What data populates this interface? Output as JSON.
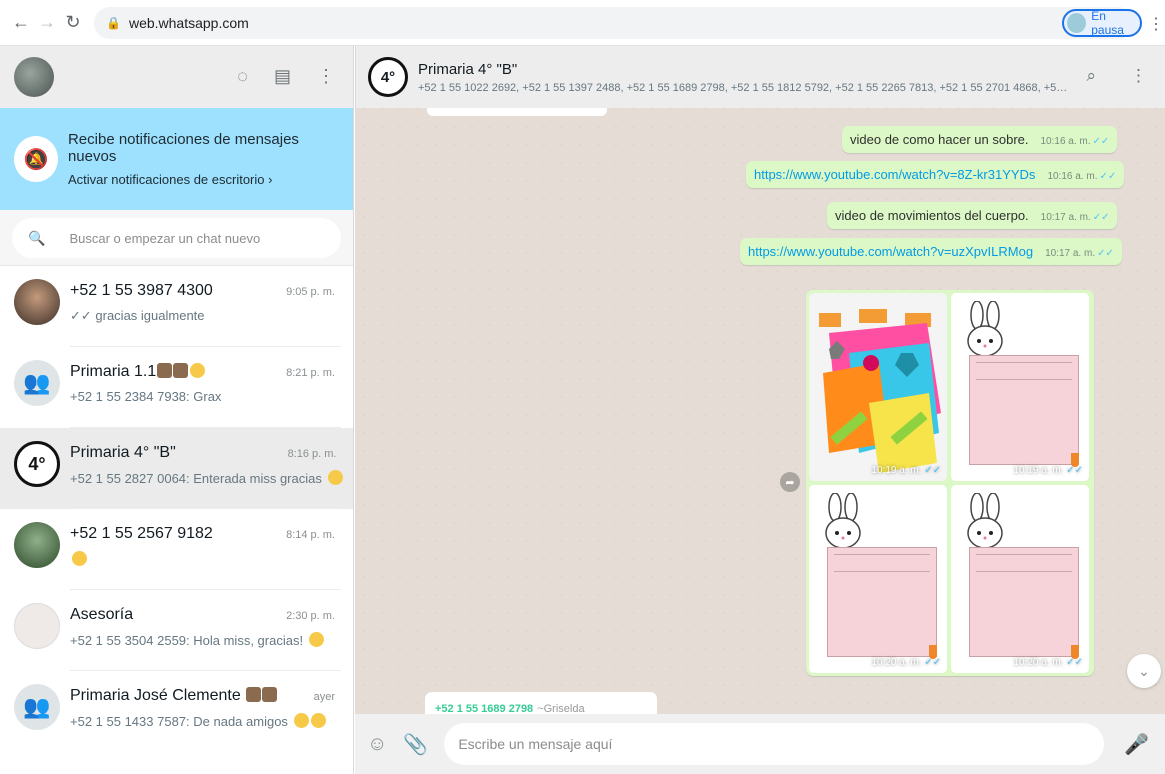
{
  "browser": {
    "url": "web.whatsapp.com",
    "profile_status": "En pausa"
  },
  "left": {
    "notification": {
      "title": "Recibe notificaciones de mensajes nuevos",
      "subtitle": "Activar notificaciones de escritorio ›"
    },
    "search": {
      "placeholder": "Buscar o empezar un chat nuevo"
    },
    "chats": [
      {
        "name": "+52 1 55 3987 4300",
        "time": "9:05 p. m.",
        "preview": "✓✓ gracias igualmente"
      },
      {
        "name": "Primaria 1.1",
        "time": "8:21 p. m.",
        "preview": "+52 1 55 2384 7938: Grax"
      },
      {
        "name": "Primaria 4° \"B\"",
        "time": "8:16 p. m.",
        "preview": "+52 1 55 2827 0064: Enterada miss gracias"
      },
      {
        "name": "+52 1 55 2567 9182",
        "time": "8:14 p. m.",
        "preview": ""
      },
      {
        "name": "Asesoría",
        "time": "2:30 p. m.",
        "preview": "+52 1 55 3504 2559: Hola miss, gracias!"
      },
      {
        "name": "Primaria José Clemente",
        "time": "ayer",
        "preview": "+52 1 55 1433 7587: De nada amigos"
      }
    ]
  },
  "conversation": {
    "title": "Primaria 4° \"B\"",
    "avatar_text": "4°",
    "members": "+52 1 55 1022 2692, +52 1 55 1397 2488, +52 1 55 1689 2798, +52 1 55 1812 5792, +52 1 55 2265 7813, +52 1 55 2701 4868, +52...",
    "messages": [
      {
        "text": "video de como hacer un sobre.",
        "time": "10:16 a. m."
      },
      {
        "text": "https://www.youtube.com/watch?v=8Z-kr31YYDs",
        "time": "10:16 a. m."
      },
      {
        "text": "video de movimientos del cuerpo.",
        "time": "10:17 a. m."
      },
      {
        "text": "https://www.youtube.com/watch?v=uzXpvILRMog",
        "time": "10:17 a. m."
      }
    ],
    "images": [
      {
        "time": "10:19 a. m."
      },
      {
        "time": "10:19 a. m."
      },
      {
        "time": "10:20 a. m."
      },
      {
        "time": "10:20 a. m."
      }
    ],
    "incoming": {
      "sender_number": "+52 1 55 1689 2798",
      "sender_name": "~Griselda"
    },
    "composer_placeholder": "Escribe un mensaje aquí"
  },
  "colors": {
    "notification_bg": "#9de1fe",
    "outgoing_bubble": "#dcf8c6",
    "read_ticks": "#4fc3f7",
    "chat_bg": "#e5ddd5"
  }
}
